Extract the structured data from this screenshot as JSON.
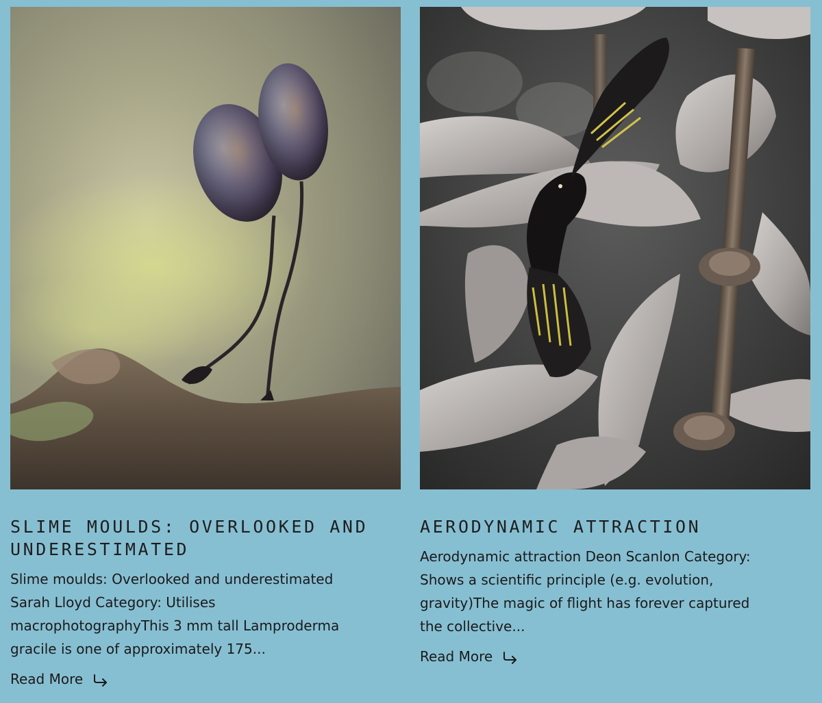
{
  "cards": [
    {
      "title": "Slime moulds: Overlooked and underestimated",
      "excerpt": "Slime moulds: Overlooked and underestimated Sarah Lloyd Category: Utilises macrophotographyThis 3 mm tall Lamproderma gracile is one of approximately 175...",
      "read_more": "Read More",
      "image_subject": "slime-mould-photo"
    },
    {
      "title": "Aerodynamic Attraction",
      "excerpt": "Aerodynamic attraction Deon Scanlon Category: Shows a scientific principle (e.g. evolution, gravity)The magic of flight has forever captured the collective...",
      "read_more": "Read More",
      "image_subject": "bird-whirligig-photo"
    }
  ],
  "colors": {
    "page_background": "#87bfd2",
    "text": "#1a1a1a"
  }
}
